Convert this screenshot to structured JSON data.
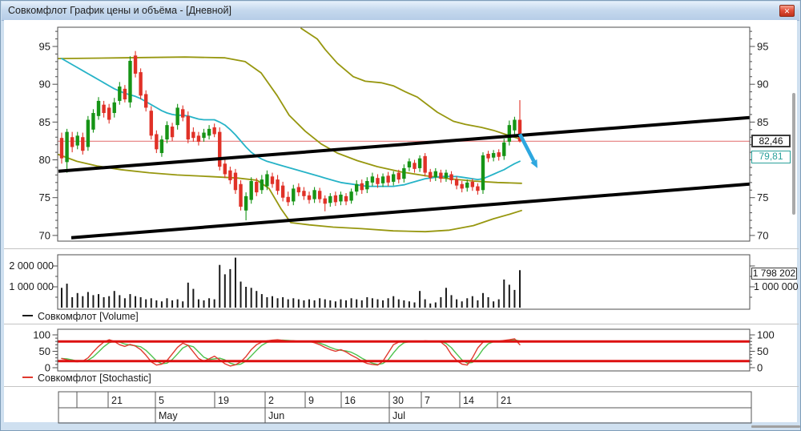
{
  "window": {
    "title": "Совкомфлот График цены и объёма - [Дневной]",
    "close_glyph": "✕"
  },
  "price_labels": {
    "last": "82,46",
    "indicator": "79,81"
  },
  "volume_labels": {
    "last": "1 798 202"
  },
  "legends": [
    {
      "label": "Совкомфлот [Volume]"
    },
    {
      "label": "Совкомфлот [Stochastic]"
    }
  ],
  "colors": {
    "up": "#169416",
    "down": "#e03127",
    "ma": "#26b3c7",
    "bands": "#97970f",
    "trend": "#000000",
    "hline": "#e57b7b",
    "volume": "#1a1a1a",
    "stoch_k": "#e0392e",
    "stoch_d": "#4cc24c",
    "stoch_band": "#dd1010",
    "axis_text": "#1a1a1a",
    "plot_border": "#4d4d4d",
    "indicator_label": "#2aa19b"
  },
  "chart_data": [
    {
      "type": "candlestick",
      "title": "Совкомфлот, дневные свечи",
      "ylim": [
        69.5,
        97.5
      ],
      "yticks": [
        "95",
        "90",
        "85",
        "80",
        "75",
        "70"
      ],
      "ytick_values": [
        95,
        90,
        85,
        80,
        75,
        70
      ],
      "candles": [
        [
          82.9,
          83.6,
          79.5,
          80.2
        ],
        [
          79.7,
          84.1,
          78.3,
          83.7
        ],
        [
          83.0,
          83.7,
          81.0,
          81.7
        ],
        [
          81.9,
          83.7,
          81.4,
          83.2
        ],
        [
          83.0,
          83.6,
          80.7,
          81.2
        ],
        [
          81.7,
          85.8,
          81.2,
          85.3
        ],
        [
          84.0,
          86.7,
          83.6,
          86.2
        ],
        [
          85.8,
          88.3,
          85.3,
          87.8
        ],
        [
          87.3,
          87.8,
          85.6,
          86.2
        ],
        [
          86.9,
          87.4,
          84.8,
          85.3
        ],
        [
          86.2,
          88.2,
          85.6,
          87.6
        ],
        [
          87.8,
          90.3,
          87.3,
          89.7
        ],
        [
          89.4,
          89.9,
          87.6,
          88.0
        ],
        [
          87.6,
          93.7,
          86.9,
          93.1
        ],
        [
          93.8,
          94.4,
          90.9,
          91.4
        ],
        [
          91.6,
          92.1,
          88.0,
          88.5
        ],
        [
          88.7,
          89.2,
          86.4,
          86.9
        ],
        [
          86.5,
          87.1,
          82.7,
          83.2
        ],
        [
          83.4,
          83.9,
          80.9,
          81.4
        ],
        [
          80.9,
          83.2,
          80.4,
          82.7
        ],
        [
          82.7,
          85.1,
          82.2,
          84.6
        ],
        [
          84.4,
          84.9,
          82.5,
          83.0
        ],
        [
          84.6,
          87.4,
          84.0,
          86.9
        ],
        [
          86.7,
          87.2,
          85.1,
          85.6
        ],
        [
          85.8,
          86.4,
          82.2,
          82.7
        ],
        [
          83.7,
          84.3,
          82.4,
          82.9
        ],
        [
          83.2,
          83.7,
          81.9,
          82.4
        ],
        [
          82.9,
          84.1,
          82.4,
          83.6
        ],
        [
          83.2,
          84.6,
          82.7,
          84.1
        ],
        [
          84.3,
          84.8,
          83.0,
          83.4
        ],
        [
          83.7,
          84.3,
          78.6,
          79.1
        ],
        [
          79.5,
          80.0,
          77.6,
          78.1
        ],
        [
          78.6,
          79.1,
          76.8,
          77.3
        ],
        [
          78.3,
          78.8,
          75.5,
          76.0
        ],
        [
          76.8,
          77.3,
          73.3,
          73.8
        ],
        [
          73.3,
          75.7,
          72.0,
          75.2
        ],
        [
          74.7,
          77.7,
          74.2,
          77.2
        ],
        [
          77.1,
          77.6,
          75.2,
          75.7
        ],
        [
          76.0,
          78.0,
          75.5,
          77.4
        ],
        [
          76.5,
          78.6,
          76.0,
          78.1
        ],
        [
          77.8,
          78.3,
          76.3,
          76.8
        ],
        [
          77.4,
          78.0,
          75.4,
          75.9
        ],
        [
          76.6,
          77.1,
          74.5,
          75.0
        ],
        [
          75.1,
          75.8,
          73.9,
          74.4
        ],
        [
          74.5,
          76.7,
          74.0,
          76.2
        ],
        [
          76.4,
          76.9,
          75.2,
          75.7
        ],
        [
          75.9,
          76.4,
          74.7,
          75.2
        ],
        [
          75.3,
          75.8,
          74.2,
          74.7
        ],
        [
          74.8,
          76.4,
          74.3,
          76.0
        ],
        [
          75.9,
          76.3,
          74.3,
          74.8
        ],
        [
          74.9,
          75.3,
          73.2,
          74.2
        ],
        [
          74.3,
          75.6,
          73.8,
          75.2
        ],
        [
          75.3,
          75.8,
          73.9,
          74.4
        ],
        [
          74.5,
          75.8,
          74.0,
          75.4
        ],
        [
          75.2,
          75.6,
          74.0,
          74.5
        ],
        [
          74.6,
          76.2,
          74.2,
          75.8
        ],
        [
          75.8,
          77.3,
          75.3,
          76.8
        ],
        [
          76.9,
          77.4,
          75.5,
          76.0
        ],
        [
          76.1,
          77.7,
          75.6,
          77.2
        ],
        [
          77.0,
          78.3,
          76.5,
          77.8
        ],
        [
          77.6,
          78.1,
          76.3,
          76.8
        ],
        [
          76.9,
          78.2,
          76.4,
          77.8
        ],
        [
          77.9,
          78.4,
          76.5,
          77.0
        ],
        [
          77.1,
          78.5,
          76.6,
          78.1
        ],
        [
          78.3,
          78.7,
          76.9,
          77.4
        ],
        [
          77.5,
          79.4,
          77.0,
          78.9
        ],
        [
          79.0,
          80.2,
          78.5,
          79.8
        ],
        [
          79.6,
          80.0,
          78.3,
          78.8
        ],
        [
          78.9,
          80.6,
          78.4,
          80.2
        ],
        [
          80.5,
          80.9,
          77.8,
          78.3
        ],
        [
          78.4,
          78.8,
          77.1,
          77.6
        ],
        [
          77.7,
          78.9,
          77.2,
          78.5
        ],
        [
          78.3,
          78.7,
          77.0,
          77.5
        ],
        [
          77.6,
          78.7,
          77.1,
          78.3
        ],
        [
          78.1,
          78.5,
          76.8,
          77.3
        ],
        [
          77.4,
          77.8,
          76.1,
          76.6
        ],
        [
          76.8,
          77.2,
          75.7,
          76.2
        ],
        [
          76.3,
          77.4,
          75.8,
          77.0
        ],
        [
          77.1,
          77.5,
          75.9,
          76.4
        ],
        [
          76.5,
          76.9,
          75.4,
          75.9
        ],
        [
          76.0,
          81.0,
          75.5,
          80.6
        ],
        [
          80.8,
          81.2,
          79.7,
          80.2
        ],
        [
          80.3,
          81.3,
          79.8,
          80.9
        ],
        [
          81.0,
          81.4,
          79.9,
          80.4
        ],
        [
          80.5,
          82.8,
          80.0,
          82.3
        ],
        [
          82.4,
          85.2,
          81.9,
          84.6
        ],
        [
          83.9,
          85.7,
          83.4,
          85.3
        ],
        [
          85.3,
          87.9,
          82.3,
          82.46
        ]
      ],
      "overlays": {
        "ma_teal": [
          93.4,
          93.0,
          92.6,
          92.2,
          91.8,
          91.4,
          91.0,
          90.6,
          90.2,
          89.8,
          89.4,
          89.1,
          88.8,
          88.6,
          88.4,
          88.1,
          87.7,
          87.3,
          86.9,
          86.5,
          86.2,
          86.0,
          85.9,
          85.9,
          85.8,
          85.6,
          85.4,
          85.3,
          85.3,
          85.3,
          85.0,
          84.6,
          84.0,
          83.3,
          82.5,
          81.7,
          81.0,
          80.5,
          80.1,
          79.8,
          79.6,
          79.4,
          79.2,
          79.0,
          78.8,
          78.6,
          78.4,
          78.2,
          78.0,
          77.8,
          77.6,
          77.4,
          77.2,
          77.0,
          76.9,
          76.8,
          76.7,
          76.6,
          76.5,
          76.5,
          76.5,
          76.5,
          76.5,
          76.5,
          76.6,
          76.7,
          76.9,
          77.1,
          77.3,
          77.5,
          77.6,
          77.7,
          77.8,
          77.8,
          77.8,
          77.8,
          77.7,
          77.6,
          77.5,
          77.4,
          77.5,
          77.8,
          78.1,
          78.4,
          78.7,
          79.1,
          79.5,
          79.81
        ],
        "band_upper_olive": [
          [
            375,
            97.4
          ],
          [
            395,
            96.0
          ],
          [
            405,
            94.6
          ],
          [
            420,
            92.8
          ],
          [
            440,
            91.0
          ],
          [
            455,
            90.4
          ],
          [
            475,
            90.2
          ],
          [
            490,
            89.8
          ],
          [
            505,
            89.0
          ],
          [
            520,
            88.3
          ],
          [
            545,
            86.3
          ],
          [
            565,
            85.1
          ],
          [
            580,
            84.7
          ],
          [
            600,
            84.3
          ],
          [
            615,
            83.9
          ],
          [
            635,
            83.2
          ],
          [
            650,
            82.7
          ]
        ],
        "band_mid_olive": [
          [
            72,
            93.4
          ],
          [
            150,
            93.5
          ],
          [
            230,
            93.6
          ],
          [
            280,
            93.5
          ],
          [
            305,
            93.0
          ],
          [
            325,
            91.5
          ],
          [
            345,
            88.5
          ],
          [
            360,
            85.9
          ],
          [
            380,
            83.8
          ],
          [
            400,
            82.1
          ],
          [
            420,
            80.9
          ],
          [
            445,
            79.9
          ],
          [
            470,
            79.1
          ],
          [
            500,
            78.4
          ],
          [
            530,
            77.9
          ],
          [
            560,
            77.5
          ],
          [
            590,
            77.2
          ],
          [
            620,
            77.0
          ],
          [
            650,
            76.9
          ]
        ],
        "band_lower_olive": [
          [
            72,
            80.7
          ],
          [
            95,
            79.8
          ],
          [
            120,
            79.2
          ],
          [
            150,
            78.7
          ],
          [
            185,
            78.3
          ],
          [
            220,
            78.0
          ],
          [
            260,
            77.8
          ],
          [
            295,
            77.6
          ],
          [
            320,
            77.3
          ],
          [
            335,
            76.2
          ],
          [
            350,
            73.5
          ],
          [
            362,
            71.7
          ],
          [
            385,
            71.4
          ],
          [
            415,
            71.1
          ],
          [
            450,
            70.9
          ],
          [
            490,
            70.6
          ],
          [
            530,
            70.5
          ],
          [
            560,
            70.7
          ],
          [
            590,
            71.3
          ],
          [
            615,
            72.2
          ],
          [
            635,
            72.8
          ],
          [
            650,
            73.3
          ]
        ],
        "trendlines": [
          {
            "x1": 72,
            "p1": 78.5,
            "x2": 935,
            "p2": 85.6
          },
          {
            "x1": 88,
            "p1": 69.7,
            "x2": 935,
            "p2": 76.8
          }
        ],
        "hline": 82.46,
        "arrow": {
          "x1": 648,
          "p1": 83.4,
          "x2": 670,
          "p2": 78.9
        }
      }
    },
    {
      "type": "bar",
      "name": "Совкомфлот [Volume]",
      "yticks": [
        "2 000 000",
        "1 000 000"
      ],
      "ytick_values_millions": [
        2,
        1
      ],
      "last_value": "1 798 202",
      "values_millions": [
        0.95,
        1.15,
        0.5,
        0.7,
        0.55,
        0.75,
        0.6,
        0.65,
        0.5,
        0.55,
        0.8,
        0.6,
        0.45,
        0.65,
        0.55,
        0.5,
        0.4,
        0.45,
        0.35,
        0.3,
        0.45,
        0.35,
        0.4,
        0.3,
        1.2,
        0.9,
        0.4,
        0.35,
        0.45,
        0.4,
        2.05,
        1.6,
        1.85,
        2.4,
        1.25,
        1.0,
        0.95,
        0.8,
        0.65,
        0.5,
        0.55,
        0.45,
        0.5,
        0.4,
        0.45,
        0.4,
        0.35,
        0.4,
        0.35,
        0.45,
        0.4,
        0.35,
        0.3,
        0.4,
        0.35,
        0.45,
        0.4,
        0.35,
        0.5,
        0.45,
        0.4,
        0.35,
        0.45,
        0.55,
        0.4,
        0.35,
        0.3,
        0.25,
        0.8,
        0.4,
        0.2,
        0.25,
        0.5,
        0.95,
        0.6,
        0.4,
        0.3,
        0.45,
        0.55,
        0.35,
        0.7,
        0.5,
        0.3,
        0.4,
        1.35,
        1.1,
        0.85,
        1.798
      ]
    },
    {
      "type": "line",
      "name": "Совкомфлот [Stochastic]",
      "ylim": [
        0,
        100
      ],
      "yticks": [
        "100",
        "50",
        "0"
      ],
      "ytick_values": [
        100,
        50,
        0
      ],
      "bands": [
        80,
        20
      ],
      "k": [
        28,
        24,
        19,
        18,
        20,
        30,
        48,
        65,
        78,
        85,
        80,
        70,
        65,
        71,
        66,
        55,
        38,
        18,
        8,
        11,
        22,
        42,
        62,
        75,
        68,
        48,
        28,
        20,
        27,
        35,
        24,
        12,
        5,
        9,
        18,
        34,
        55,
        70,
        78,
        82,
        84,
        85,
        83,
        81,
        82,
        80,
        81,
        80,
        76,
        70,
        62,
        55,
        50,
        55,
        48,
        38,
        30,
        20,
        13,
        10,
        8,
        20,
        45,
        70,
        78,
        80,
        79,
        81,
        80,
        82,
        81,
        80,
        78,
        65,
        40,
        22,
        11,
        8,
        30,
        60,
        78,
        80,
        79,
        81,
        83,
        85,
        88,
        70
      ],
      "d": [
        28,
        27,
        24,
        20,
        19,
        23,
        33,
        48,
        64,
        76,
        81,
        78,
        72,
        69,
        67,
        64,
        53,
        37,
        21,
        12,
        14,
        25,
        42,
        60,
        68,
        64,
        48,
        32,
        25,
        27,
        29,
        24,
        14,
        9,
        11,
        20,
        36,
        53,
        68,
        77,
        81,
        84,
        84,
        83,
        82,
        81,
        81,
        80,
        79,
        75,
        69,
        62,
        56,
        53,
        51,
        47,
        39,
        29,
        21,
        14,
        10,
        13,
        24,
        45,
        64,
        76,
        79,
        80,
        80,
        81,
        81,
        81,
        80,
        74,
        61,
        42,
        24,
        14,
        16,
        33,
        56,
        73,
        79,
        80,
        81,
        83,
        85,
        81
      ]
    },
    {
      "type": "table",
      "name": "date-axis",
      "day_bounds": [
        72,
        95,
        134,
        193,
        267,
        330,
        380,
        425,
        485,
        525,
        573,
        620,
        937
      ],
      "day_labels": [
        "",
        "",
        "21",
        "5",
        "19",
        "2",
        "9",
        "16",
        "30",
        "7",
        "14",
        "21"
      ],
      "month_bounds": [
        72,
        193,
        330,
        485,
        937
      ],
      "month_labels": [
        "",
        "May",
        "Jun",
        "Jul"
      ]
    }
  ]
}
